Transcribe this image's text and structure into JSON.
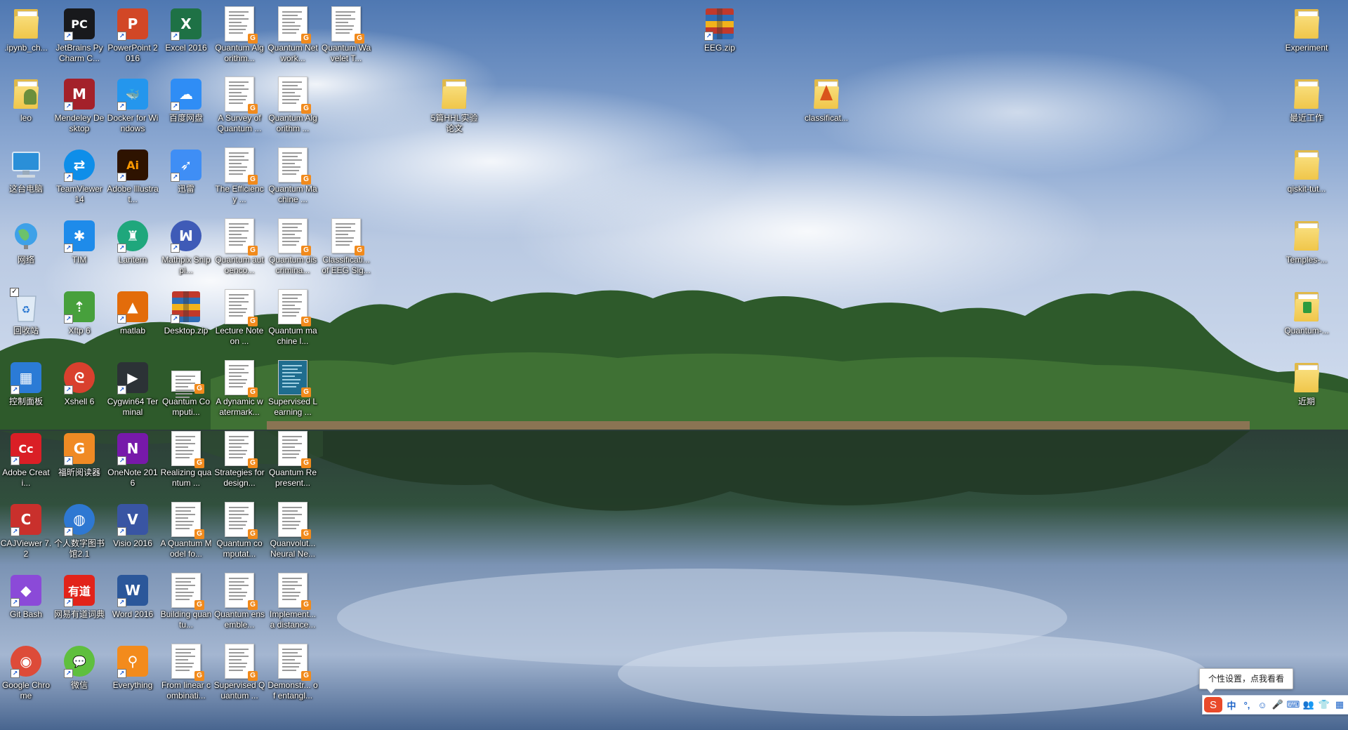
{
  "desktop": {
    "icons": [
      {
        "label": ".ipynb_ch...",
        "type": "folder"
      },
      {
        "label": "JetBrains PyCharm C...",
        "type": "app",
        "text": "PC",
        "color": "#18191c"
      },
      {
        "label": "PowerPoint 2016",
        "type": "app",
        "text": "P",
        "color": "#d24726"
      },
      {
        "label": "Excel 2016",
        "type": "app",
        "text": "X",
        "color": "#1e7145"
      },
      {
        "label": "Quantum Algorithm...",
        "type": "pdf"
      },
      {
        "label": "Quantum Network...",
        "type": "pdf"
      },
      {
        "label": "Quantum Wavelet T...",
        "type": "pdf"
      },
      {
        "label": "leo",
        "type": "userfolder"
      },
      {
        "label": "Mendeley Desktop",
        "type": "app",
        "text": "M",
        "color": "#a4212a"
      },
      {
        "label": "Docker for Windows",
        "type": "app",
        "text": "🐳",
        "color": "#2496ed"
      },
      {
        "label": "百度网盘",
        "type": "app",
        "text": "☁",
        "color": "#2f8df5"
      },
      {
        "label": "A Survey of Quantum ...",
        "type": "pdf"
      },
      {
        "label": "Quantum Algorithm ...",
        "type": "pdf"
      },
      {
        "label": "这台电脑",
        "type": "pc"
      },
      {
        "label": "TeamViewer 14",
        "type": "app",
        "text": "⇄",
        "color": "#0e8ee9",
        "round": true
      },
      {
        "label": "Adobe Illustrat...",
        "type": "app",
        "text": "Ai",
        "color": "#2e1300",
        "fg": "#ff9a00"
      },
      {
        "label": "迅雷",
        "type": "app",
        "text": "➶",
        "color": "#3f8ef5"
      },
      {
        "label": "The Efficiency ...",
        "type": "pdf"
      },
      {
        "label": "Quantum Machine ...",
        "type": "pdf"
      },
      {
        "label": "网络",
        "type": "net"
      },
      {
        "label": "TIM",
        "type": "app",
        "text": "✱",
        "color": "#1e8bea"
      },
      {
        "label": "Lantern",
        "type": "app",
        "text": "♜",
        "color": "#1fa77c",
        "round": true
      },
      {
        "label": "Mathpix Snippi...",
        "type": "app",
        "text": "ꟽ",
        "color": "#3f5bb7",
        "round": true
      },
      {
        "label": "Quantum autoenco...",
        "type": "pdf"
      },
      {
        "label": "Quantum discrimina...",
        "type": "pdf"
      },
      {
        "label": "Classificati... of EEG Sig...",
        "type": "pdf"
      },
      {
        "label": "回收站",
        "type": "bin"
      },
      {
        "label": "Xftp 6",
        "type": "app",
        "text": "⇡",
        "color": "#47a03c"
      },
      {
        "label": "matlab",
        "type": "app",
        "text": "▲",
        "color": "#e36c0a"
      },
      {
        "label": "Desktop.zip",
        "type": "zip"
      },
      {
        "label": "Lecture Note on ...",
        "type": "pdf"
      },
      {
        "label": "Quantum machine l...",
        "type": "pdf"
      },
      {
        "label": "控制面板",
        "type": "app",
        "text": "▦",
        "color": "#2b7bd6"
      },
      {
        "label": "Xshell 6",
        "type": "app",
        "text": "ᘓ",
        "color": "#d9402e",
        "round": true
      },
      {
        "label": "Cygwin64 Terminal",
        "type": "app",
        "text": "▶",
        "color": "#2c3236"
      },
      {
        "label": "Quantum Computi...",
        "type": "doc"
      },
      {
        "label": "A dynamic watermark...",
        "type": "pdf"
      },
      {
        "label": "Supervised Learning ...",
        "type": "book"
      },
      {
        "label": "Adobe Creati...",
        "type": "app",
        "text": "Cc",
        "color": "#da1f26"
      },
      {
        "label": "福昕阅读器",
        "type": "app",
        "text": "G",
        "color": "#f08a24"
      },
      {
        "label": "OneNote 2016",
        "type": "app",
        "text": "N",
        "color": "#7719aa"
      },
      {
        "label": "Realizing quantum ...",
        "type": "pdf"
      },
      {
        "label": "Strategies for design...",
        "type": "pdf"
      },
      {
        "label": "Quantum Represent...",
        "type": "pdf"
      },
      {
        "label": "CAJViewer 7.2",
        "type": "app",
        "text": "C",
        "color": "#c9302c"
      },
      {
        "label": "个人数字图书馆2.1",
        "type": "app",
        "text": "◍",
        "color": "#2e78d2",
        "round": true
      },
      {
        "label": "Visio 2016",
        "type": "app",
        "text": "V",
        "color": "#3955a3"
      },
      {
        "label": "A Quantum Model fo...",
        "type": "pdf"
      },
      {
        "label": "Quantum computat...",
        "type": "pdf"
      },
      {
        "label": "Quanvolut... Neural Ne...",
        "type": "pdf"
      },
      {
        "label": "Git Bash",
        "type": "app",
        "text": "◆",
        "color": "#8b4ad8"
      },
      {
        "label": "网易有道词典",
        "type": "app",
        "text": "有道",
        "color": "#e2231a"
      },
      {
        "label": "Word 2016",
        "type": "app",
        "text": "W",
        "color": "#2b579a"
      },
      {
        "label": "Building quantu...",
        "type": "pdf"
      },
      {
        "label": "Quantum ensemble...",
        "type": "pdf"
      },
      {
        "label": "Implement... a distance...",
        "type": "pdf"
      },
      {
        "label": "Google Chrome",
        "type": "app",
        "text": "◉",
        "color": "#dd4b39",
        "round": true
      },
      {
        "label": "微信",
        "type": "app",
        "text": "💬",
        "color": "#5fbf3e",
        "round": true
      },
      {
        "label": "Everything",
        "type": "app",
        "text": "⚲",
        "color": "#f38b1c"
      },
      {
        "label": "From linear combinati...",
        "type": "pdf"
      },
      {
        "label": "Supervised Quantum ...",
        "type": "pdf"
      },
      {
        "label": "Demonstr... of entangl...",
        "type": "pdf"
      },
      {
        "label": "EEG.zip",
        "type": "zip"
      },
      {
        "label": "5篇HHL实验论文",
        "type": "folder"
      },
      {
        "label": "classificat...",
        "type": "matlabfolder"
      },
      {
        "label": "Experiment",
        "type": "folder"
      },
      {
        "label": "最近工作",
        "type": "folder"
      },
      {
        "label": "qiskit-tut...",
        "type": "folder"
      },
      {
        "label": "Temples-...",
        "type": "folder"
      },
      {
        "label": "Quantum-...",
        "type": "greenfolder"
      },
      {
        "label": "近期",
        "type": "folder"
      }
    ]
  },
  "tooltip": {
    "text": "个性设置，点我看看"
  },
  "ime": {
    "logo": "S",
    "items": [
      "中",
      "°,",
      "☺",
      "🎤",
      "⌨",
      "👥",
      "👕",
      "▦"
    ]
  },
  "recycle_checkbox": "✓"
}
